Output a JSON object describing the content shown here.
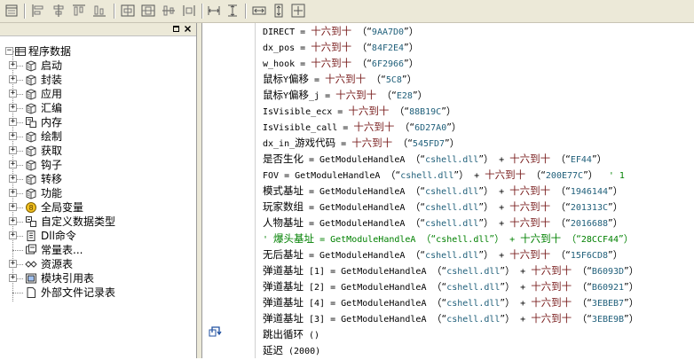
{
  "tree": {
    "root_label": "程序数据",
    "items": [
      {
        "label": "启动",
        "icon": "book-icon",
        "expandable": true
      },
      {
        "label": "封装",
        "icon": "book-icon",
        "expandable": true
      },
      {
        "label": "应用",
        "icon": "book-icon",
        "expandable": true
      },
      {
        "label": "汇编",
        "icon": "book-icon",
        "expandable": true
      },
      {
        "label": "内存",
        "icon": "module-icon",
        "expandable": true
      },
      {
        "label": "绘制",
        "icon": "book-icon",
        "expandable": true
      },
      {
        "label": "获取",
        "icon": "book-icon",
        "expandable": true
      },
      {
        "label": "钩子",
        "icon": "book-icon",
        "expandable": true
      },
      {
        "label": "转移",
        "icon": "book-icon",
        "expandable": true
      },
      {
        "label": "功能",
        "icon": "book-icon",
        "expandable": true
      },
      {
        "label": "全局变量",
        "icon": "global-var-icon",
        "expandable": true
      },
      {
        "label": "自定义数据类型",
        "icon": "datatype-icon",
        "expandable": true
      },
      {
        "label": "Dll命令",
        "icon": "dll-icon",
        "expandable": true
      },
      {
        "label": "常量表...",
        "icon": "constant-icon",
        "expandable": false
      },
      {
        "label": "资源表",
        "icon": "resource-icon",
        "expandable": true
      },
      {
        "label": "模块引用表",
        "icon": "module-ref-icon",
        "expandable": true
      },
      {
        "label": "外部文件记录表",
        "icon": "file-icon",
        "expandable": false
      }
    ]
  },
  "code_lines": [
    {
      "type": "assign",
      "name": "DIRECT",
      "fn": "十六到十",
      "arg": "9AA7D0"
    },
    {
      "type": "assign",
      "name": "dx_pos",
      "fn": "十六到十",
      "arg": "84F2E4"
    },
    {
      "type": "assign",
      "name": "w_hook",
      "fn": "十六到十",
      "arg": "6F2966"
    },
    {
      "type": "assign",
      "name": "鼠标Y偏移",
      "fn": "十六到十",
      "arg": "5C8"
    },
    {
      "type": "assign",
      "name": "鼠标Y偏移_j",
      "fn": "十六到十",
      "arg": "E28"
    },
    {
      "type": "assign",
      "name": "IsVisible_ecx",
      "fn": "十六到十",
      "arg": "88B19C"
    },
    {
      "type": "assign",
      "name": "IsVisible_call",
      "fn": "十六到十",
      "arg": "6D27A0"
    },
    {
      "type": "assign",
      "name": "dx_in_游戏代码",
      "fn": "十六到十",
      "arg": "545FD7"
    },
    {
      "type": "module",
      "name": "是否生化",
      "module": "cshell.dll",
      "arg": "EF44",
      "suffix": ""
    },
    {
      "type": "module",
      "name": "FOV",
      "module": "cshell.dll",
      "arg": "200E77C",
      "suffix": "' 1"
    },
    {
      "type": "module",
      "name": "模式基址",
      "module": "cshell.dll",
      "arg": "1946144",
      "suffix": ""
    },
    {
      "type": "module",
      "name": "玩家数组",
      "module": "cshell.dll",
      "arg": "201313C",
      "suffix": ""
    },
    {
      "type": "module",
      "name": "人物基址",
      "module": "cshell.dll",
      "arg": "2016688",
      "suffix": ""
    },
    {
      "type": "comment",
      "name": "' 爆头基址",
      "module": "cshell.dll",
      "arg": "28CCF44",
      "suffix": ""
    },
    {
      "type": "module",
      "name": "无后基址",
      "module": "cshell.dll",
      "arg": "15F6CD8",
      "suffix": ""
    },
    {
      "type": "module",
      "name": "弹道基址 [1]",
      "module": "cshell.dll",
      "arg": "B6093D",
      "suffix": ""
    },
    {
      "type": "module",
      "name": "弹道基址 [2]",
      "module": "cshell.dll",
      "arg": "B60921",
      "suffix": ""
    },
    {
      "type": "module",
      "name": "弹道基址 [4]",
      "module": "cshell.dll",
      "arg": "3EBEB7",
      "suffix": ""
    },
    {
      "type": "module",
      "name": "弹道基址 [3]",
      "module": "cshell.dll",
      "arg": "3EBE9B",
      "suffix": ""
    },
    {
      "type": "call",
      "text": "跳出循环 ()"
    },
    {
      "type": "call",
      "text": "延迟 (2000)"
    }
  ],
  "code_tokens": {
    "module_fn": "GetModuleHandleA",
    "assign_op": "=",
    "plus_op": "+",
    "hex_fn": "十六到十"
  },
  "colors": {
    "function": "#7a1f1f",
    "string": "#1f5f7a",
    "comment": "#008000"
  }
}
